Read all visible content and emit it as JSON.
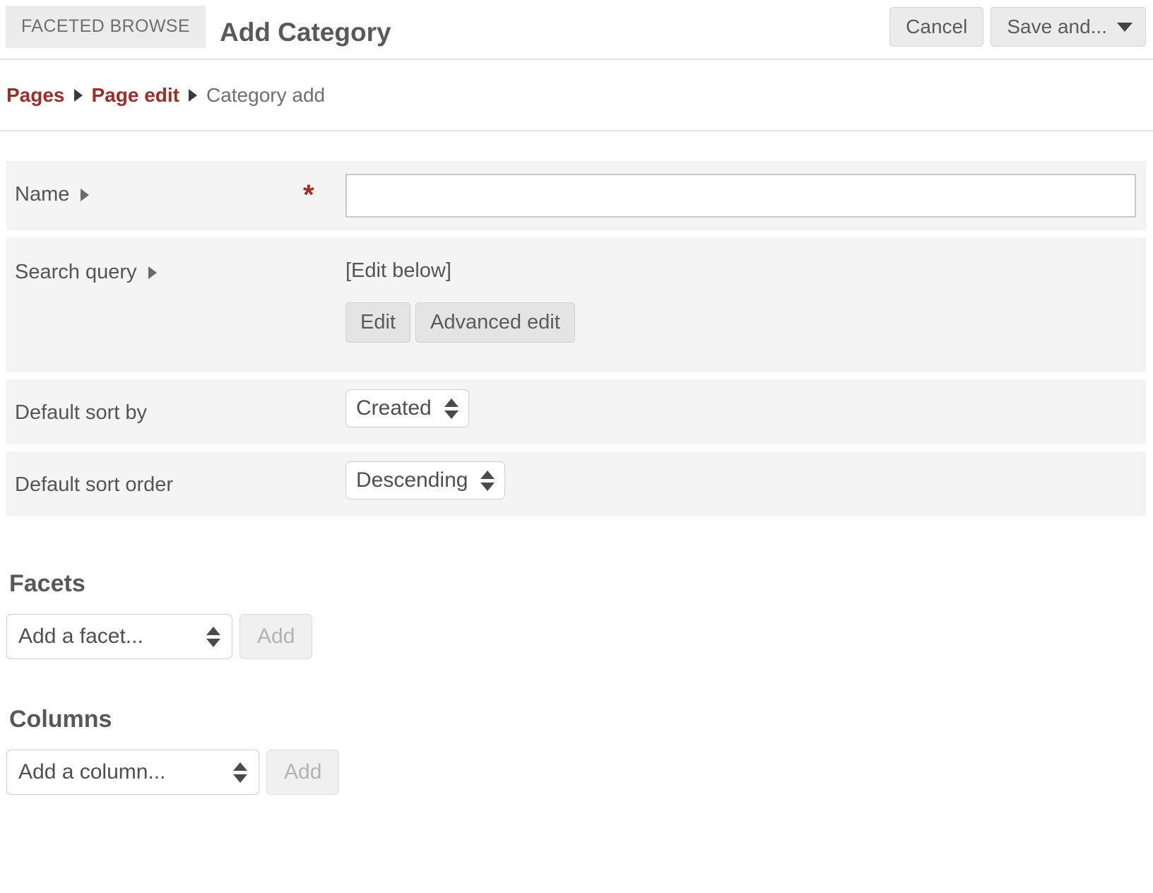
{
  "header": {
    "app_badge": "FACETED BROWSE",
    "title": "Add Category",
    "cancel_label": "Cancel",
    "save_label": "Save and...",
    "save_caret_icon": "caret-down-icon"
  },
  "breadcrumb": {
    "items": [
      {
        "label": "Pages",
        "link": true
      },
      {
        "label": "Page edit",
        "link": true
      },
      {
        "label": "Category add",
        "link": false
      }
    ],
    "separator_icon": "caret-right-icon"
  },
  "form": {
    "name": {
      "label": "Name",
      "disclosure_icon": "caret-right-icon",
      "required_marker": "*",
      "value": "",
      "placeholder": ""
    },
    "search_query": {
      "label": "Search query",
      "disclosure_icon": "caret-right-icon",
      "value": "[Edit below]",
      "edit_label": "Edit",
      "advanced_edit_label": "Advanced edit"
    },
    "default_sort_by": {
      "label": "Default sort by",
      "value": "Created",
      "stepper_icon": "up-down-stepper-icon"
    },
    "default_sort_order": {
      "label": "Default sort order",
      "value": "Descending",
      "stepper_icon": "up-down-stepper-icon"
    }
  },
  "facets": {
    "title": "Facets",
    "select_value": "Add a facet...",
    "add_label": "Add",
    "stepper_icon": "up-down-stepper-icon"
  },
  "columns": {
    "title": "Columns",
    "select_value": "Add a column...",
    "add_label": "Add",
    "stepper_icon": "up-down-stepper-icon"
  },
  "colors": {
    "link": "#9d2d28",
    "required": "#a02c28",
    "row_bg": "#f4f4f4",
    "badge_bg": "#ececec",
    "text": "#555555"
  }
}
